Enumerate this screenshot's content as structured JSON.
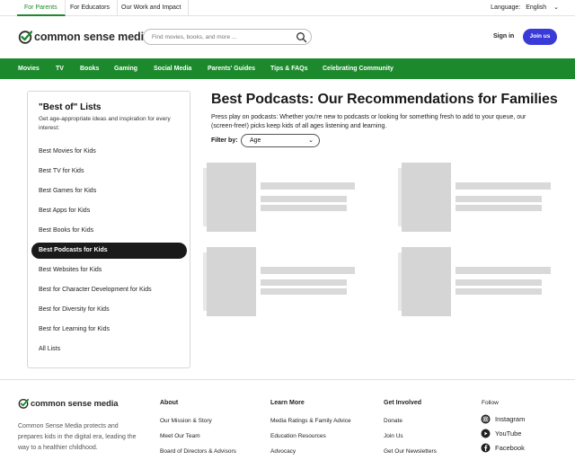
{
  "util": {
    "tabs": [
      "For Parents",
      "For Educators",
      "Our Work and Impact"
    ],
    "language_label": "Language:",
    "language_value": "English"
  },
  "header": {
    "logo_text": "common sense media",
    "search_placeholder": "Find movies, books, and more ...",
    "sign_in": "Sign in",
    "join": "Join us"
  },
  "nav": [
    "Movies",
    "TV",
    "Books",
    "Gaming",
    "Social Media",
    "Parents' Guides",
    "Tips & FAQs",
    "Celebrating Community"
  ],
  "sidebar": {
    "title": "\"Best of\" Lists",
    "description": "Get age-appropriate ideas and inspiration for every interest:",
    "items": [
      "Best Movies for Kids",
      "Best TV for Kids",
      "Best Games for Kids",
      "Best Apps for Kids",
      "Best Books for Kids",
      "Best Podcasts for Kids",
      "Best Websites for Kids",
      "Best for Character Development for Kids",
      "Best for Diversity for Kids",
      "Best for Learning for Kids",
      "All Lists"
    ],
    "active_index": 5
  },
  "main": {
    "title": "Best Podcasts: Our Recommendations for Families",
    "intro": "Press play on podcasts: Whether you're new to podcasts or looking for something fresh to add to your queue, our (screen-free!) picks keep kids of all ages listening and learning.",
    "filter_label": "Filter by:",
    "filter_value": "Age"
  },
  "footer": {
    "logo_text": "common sense media",
    "description": "Common Sense Media protects and prepares kids in the digital era, leading the way to a healthier childhood.",
    "columns": [
      {
        "heading": "About",
        "links": [
          "Our Mission & Story",
          "Meet Our Team",
          "Board of Directors & Advisors"
        ]
      },
      {
        "heading": "Learn More",
        "links": [
          "Media Ratings & Family Advice",
          "Education Resources",
          "Advocacy"
        ]
      },
      {
        "heading": "Get Involved",
        "links": [
          "Donate",
          "Join Us",
          "Get Our Newsletters"
        ]
      }
    ],
    "follow_label": "Follow",
    "social": [
      "Instagram",
      "YouTube",
      "Facebook"
    ]
  },
  "colors": {
    "brand_green": "#1c8a2c",
    "join_button": "#3a3ad9",
    "active_item": "#1a1a1a"
  }
}
